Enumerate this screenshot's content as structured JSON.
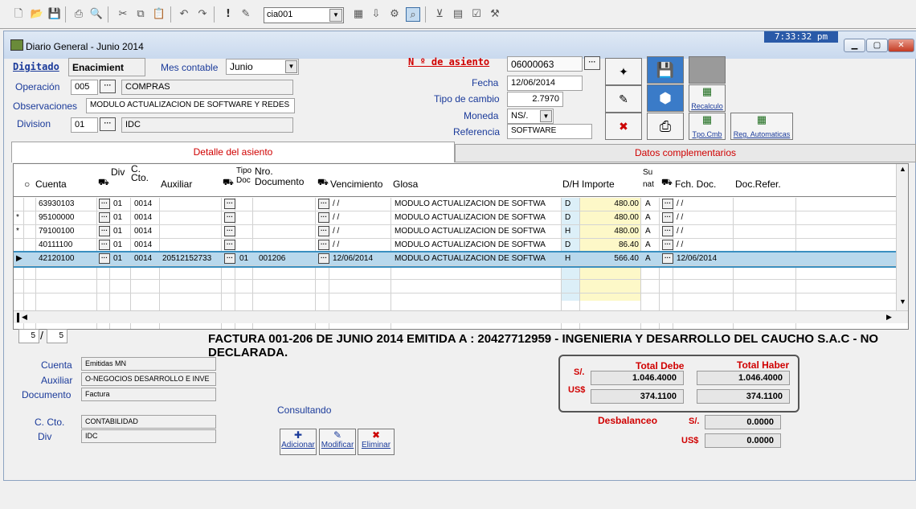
{
  "toolbar": {
    "company_select": "cia001",
    "icons": [
      "new-icon",
      "open-icon",
      "save-icon",
      "print-icon",
      "print-preview-icon",
      "cut-icon",
      "copy-icon",
      "paste-icon",
      "undo-icon",
      "redo-icon",
      "alert-icon",
      "edit-icon",
      "company-select",
      "grid-icon",
      "export-icon",
      "settings-icon",
      "search-icon",
      "filter-icon",
      "chart-icon",
      "checklist-icon",
      "tools-icon"
    ]
  },
  "window": {
    "title": "Diario General   - Junio 2014",
    "clock": "7:33:32 pm"
  },
  "form": {
    "digitado_label": "Digitado",
    "digitado_value": "Enacimient",
    "mes_label": "Mes contable",
    "mes_value": "Junio",
    "asiento_label": "N º de asiento",
    "asiento_value": "06000063",
    "operacion_label": "Operación",
    "operacion_code": "005",
    "operacion_desc": "COMPRAS",
    "obs_label": "Observaciones",
    "obs_value": "MODULO ACTUALIZACION DE SOFTWARE Y REDES",
    "division_label": "Division",
    "division_code": "01",
    "division_desc": "IDC",
    "fecha_label": "Fecha",
    "fecha_value": "12/06/2014",
    "tc_label": "Tipo de cambio",
    "tc_value": "2.7970",
    "moneda_label": "Moneda",
    "moneda_value": "NS/.",
    "ref_label": "Referencia",
    "ref_value": "SOFTWARE"
  },
  "buttons": {
    "recalculo": "Recalculo",
    "tipo_cmb": "Tpo.Cmb",
    "reg_auto": "Reg. Automaticas"
  },
  "tabs": [
    "Detalle del asiento",
    "Datos complementarios"
  ],
  "grid": {
    "headers": {
      "cuenta": "Cuenta",
      "div": "Div",
      "ccto": "C. Cto.",
      "auxiliar": "Auxiliar",
      "tipo_doc": "Tipo Doc",
      "nro_doc": "Nro. Documento",
      "vencimiento": "Vencimiento",
      "glosa": "Glosa",
      "dh": "D/H",
      "importe": "Importe",
      "sunat": "Su nat",
      "fch_doc": "Fch. Doc.",
      "doc_refer": "Doc.Refer."
    },
    "rows": [
      {
        "mark": "",
        "cuenta": "63930103",
        "div": "01",
        "ccto": "0014",
        "auxiliar": "",
        "tipo": "",
        "nro": "",
        "venc": "/ /",
        "glosa": "MODULO ACTUALIZACION DE SOFTWA",
        "dh": "D",
        "importe": "480.00",
        "sunat": "A",
        "fch": "/ /"
      },
      {
        "mark": "*",
        "cuenta": "95100000",
        "div": "01",
        "ccto": "0014",
        "auxiliar": "",
        "tipo": "",
        "nro": "",
        "venc": "/ /",
        "glosa": "MODULO ACTUALIZACION DE SOFTWA",
        "dh": "D",
        "importe": "480.00",
        "sunat": "A",
        "fch": "/ /"
      },
      {
        "mark": "*",
        "cuenta": "79100100",
        "div": "01",
        "ccto": "0014",
        "auxiliar": "",
        "tipo": "",
        "nro": "",
        "venc": "/ /",
        "glosa": "MODULO ACTUALIZACION DE SOFTWA",
        "dh": "H",
        "importe": "480.00",
        "sunat": "A",
        "fch": "/ /"
      },
      {
        "mark": "",
        "cuenta": "40111100",
        "div": "01",
        "ccto": "0014",
        "auxiliar": "",
        "tipo": "",
        "nro": "",
        "venc": "/ /",
        "glosa": "MODULO ACTUALIZACION DE SOFTWA",
        "dh": "D",
        "importe": "86.40",
        "sunat": "A",
        "fch": "/ /"
      },
      {
        "mark": "▶",
        "cuenta": "42120100",
        "div": "01",
        "ccto": "0014",
        "auxiliar": "20512152733",
        "tipo": "01",
        "nro": "001206",
        "venc": "12/06/2014",
        "glosa": "MODULO ACTUALIZACION DE SOFTWA",
        "dh": "H",
        "importe": "566.40",
        "sunat": "A",
        "fch": "12/06/2014"
      }
    ]
  },
  "counter": {
    "current": "5",
    "total": "5"
  },
  "factura_text": "FACTURA 001-206 DE JUNIO 2014 EMITIDA A : 20427712959 - INGENIERIA Y DESARROLLO DEL CAUCHO S.A.C - NO DECLARADA.",
  "info": {
    "cuenta_label": "Cuenta",
    "cuenta_value": "Emitidas MN",
    "auxiliar_label": "Auxiliar",
    "auxiliar_value": "O-NEGOCIOS DESARROLLO E INVE",
    "documento_label": "Documento",
    "documento_value": "Factura",
    "ccto_label": "C. Cto.",
    "ccto_value": "CONTABILIDAD",
    "div_label": "Div",
    "div_value": "IDC"
  },
  "status": "Consultando",
  "actions": {
    "adicionar": "Adicionar",
    "modificar": "Modificar",
    "eliminar": "Eliminar"
  },
  "totals": {
    "debe_label": "Total Debe",
    "haber_label": "Total Haber",
    "soles_label": "S/.",
    "usd_label": "US$",
    "debe_soles": "1.046.4000",
    "haber_soles": "1.046.4000",
    "debe_usd": "374.1100",
    "haber_usd": "374.1100",
    "desbalanceo_label": "Desbalanceo",
    "desb_soles": "0.0000",
    "desb_usd": "0.0000"
  }
}
